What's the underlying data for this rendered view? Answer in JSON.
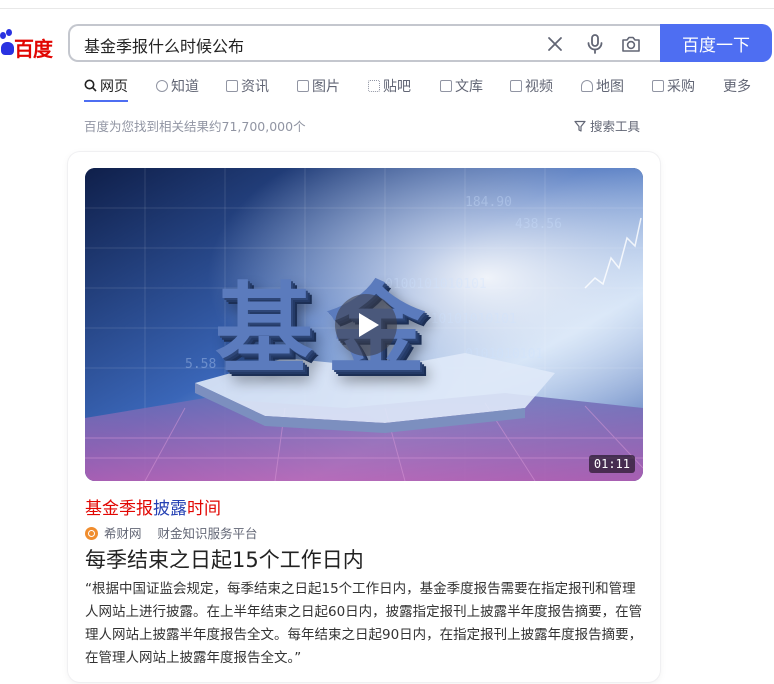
{
  "logo": {
    "text": "百度"
  },
  "search": {
    "query": "基金季报什么时候公布",
    "button_label": "百度一下",
    "clear_icon": "close-icon",
    "voice_icon": "microphone-icon",
    "image_icon": "camera-icon"
  },
  "tabs": [
    {
      "label": "网页",
      "icon": "search-icon",
      "active": true
    },
    {
      "label": "知道",
      "icon": "question-icon"
    },
    {
      "label": "资讯",
      "icon": "news-icon"
    },
    {
      "label": "图片",
      "icon": "image-icon"
    },
    {
      "label": "贴吧",
      "icon": "tieba-icon"
    },
    {
      "label": "文库",
      "icon": "document-icon"
    },
    {
      "label": "视频",
      "icon": "video-icon"
    },
    {
      "label": "地图",
      "icon": "map-icon"
    },
    {
      "label": "采购",
      "icon": "shop-icon"
    },
    {
      "label": "更多"
    }
  ],
  "result_count": "百度为您找到相关结果约71,700,000个",
  "search_tools": "搜索工具",
  "result": {
    "video_thumbnail_text": "基金",
    "duration": "01:11",
    "title_part1": "基金季报",
    "title_part2": "披露",
    "title_part3": "时间",
    "source_name": "希财网",
    "source_desc": "财金知识服务平台",
    "answer": "每季结束之日起15个工作日内",
    "snippet": "“根据中国证监会规定，每季结束之日起15个工作日内，基金季度报告需要在指定报刊和管理人网站上进行披露。在上半年结束之日起60日内，披露指定报刊上披露半年度报告摘要，在管理人网站上披露半年度报告全文。每年结束之日起90日内，在指定报刊上披露年度报告摘要，在管理人网站上披露年度报告全文。”"
  },
  "colors": {
    "accent": "#4e6ef2",
    "title_red": "#e10602",
    "title_blue": "#2440b3"
  }
}
